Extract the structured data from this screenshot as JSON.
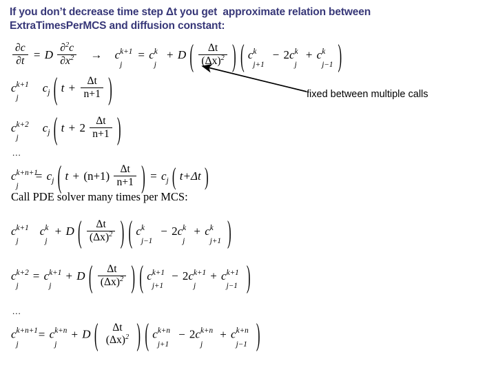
{
  "slide": {
    "background_color": "#ffffff",
    "heading": {
      "color": "#373778",
      "line1": "If you don’t decrease time step Δt you get  approximate relation between",
      "line2": "ExtraTimesPerMCS and diffusion constant:"
    },
    "annotation": {
      "text": "fixed between multiple calls",
      "color": "#000000",
      "points_to": "delta-t-over-delta-x-squared"
    },
    "body_text": {
      "call_solver": "Call PDE solver many times per MCS:",
      "ellipsis": "..."
    },
    "equations": {
      "pde": {
        "lhs_numerator": "∂c",
        "lhs_denominator": "∂t",
        "coef": "D",
        "rhs_numerator": "∂",
        "rhs_numerator_exp": "2",
        "rhs_numerator_var": "c",
        "rhs_denominator": "∂x",
        "rhs_denominator_exp": "2",
        "implies": "→",
        "disc_lhs_var": "c",
        "disc_lhs_sub": "j",
        "disc_lhs_sup": "k+1",
        "eq": "=",
        "disc_t1_var": "c",
        "disc_t1_sub": "j",
        "disc_t1_sup": "k",
        "plus": "+",
        "disc_coef": "D",
        "frac_num": "Δt",
        "frac_den": "(Δx)",
        "frac_den_exp": "2",
        "term1_var": "c",
        "term1_sub": "j+1",
        "term1_sup": "k",
        "minus": "−",
        "term2_coef": "2",
        "term2_var": "c",
        "term2_sub": "j",
        "term2_sup": "k",
        "term3_var": "c",
        "term3_sub": "j−1",
        "term3_sup": "k"
      },
      "rel1": {
        "lhs_var": "c",
        "lhs_sub": "j",
        "lhs_sup": "k+1",
        "rhs_var": "c",
        "rhs_sub": "j",
        "arg_t": "t",
        "arg_plus": "+",
        "arg_num": "Δt",
        "arg_den": "n+1"
      },
      "rel2": {
        "lhs_var": "c",
        "lhs_sub": "j",
        "lhs_sup": "k+2",
        "rhs_var": "c",
        "rhs_sub": "j",
        "arg_t": "t",
        "arg_plus": "+",
        "arg_coef": "2",
        "arg_num": "Δt",
        "arg_den": "n+1"
      },
      "reln": {
        "lhs_var": "c",
        "lhs_sub": "j",
        "lhs_sup": "k+n+1",
        "eq1": "=",
        "mid_var": "c",
        "mid_sub": "j",
        "arg_t": "t",
        "arg_plus": "+",
        "arg_coef": "(n+1)",
        "arg_num": "Δt",
        "arg_den": "n+1",
        "eq2": "=",
        "end_var": "c",
        "end_sub": "j",
        "end_arg": "t+Δt"
      },
      "solver1": {
        "lhs_var": "c",
        "lhs_sub": "j",
        "lhs_sup": "k+1",
        "eq": "=",
        "t1_var": "c",
        "t1_sub": "j",
        "t1_sup": "k",
        "plus": "+",
        "coef": "D",
        "frac_num": "Δt",
        "frac_den": "(Δx)",
        "frac_den_exp": "2",
        "p1_var": "c",
        "p1_sub": "j−1",
        "p1_sup": "k",
        "minus": "−",
        "p2_coef": "2",
        "p2_var": "c",
        "p2_sub": "j",
        "p2_sup": "k",
        "p3_var": "c",
        "p3_sub": "j+1",
        "p3_sup": "k"
      },
      "solver2": {
        "lhs_var": "c",
        "lhs_sub": "j",
        "lhs_sup": "k+2",
        "eq": "=",
        "t1_var": "c",
        "t1_sub": "j",
        "t1_sup": "k+1",
        "plus": "+",
        "coef": "D",
        "frac_num": "Δt",
        "frac_den": "(Δx)",
        "frac_den_exp": "2",
        "p1_var": "c",
        "p1_sub": "j+1",
        "p1_sup": "k+1",
        "minus": "−",
        "p2_coef": "2",
        "p2_var": "c",
        "p2_sub": "j",
        "p2_sup": "k+1",
        "p3_var": "c",
        "p3_sub": "j−1",
        "p3_sup": "k+1"
      },
      "solvern": {
        "lhs_var": "c",
        "lhs_sub": "j",
        "lhs_sup": "k+n+1",
        "eq": "=",
        "t1_var": "c",
        "t1_sub": "j",
        "t1_sup": "k+n",
        "plus": "+",
        "coef": "D",
        "frac_num": "Δt",
        "frac_den": "(Δx)",
        "frac_den_exp": "2",
        "p1_var": "c",
        "p1_sub": "j+1",
        "p1_sup": "k+n",
        "minus": "−",
        "p2_coef": "2",
        "p2_var": "c",
        "p2_sub": "j",
        "p2_sup": "k+n",
        "p3_var": "c",
        "p3_sub": "j−1",
        "p3_sup": "k+n"
      }
    }
  }
}
